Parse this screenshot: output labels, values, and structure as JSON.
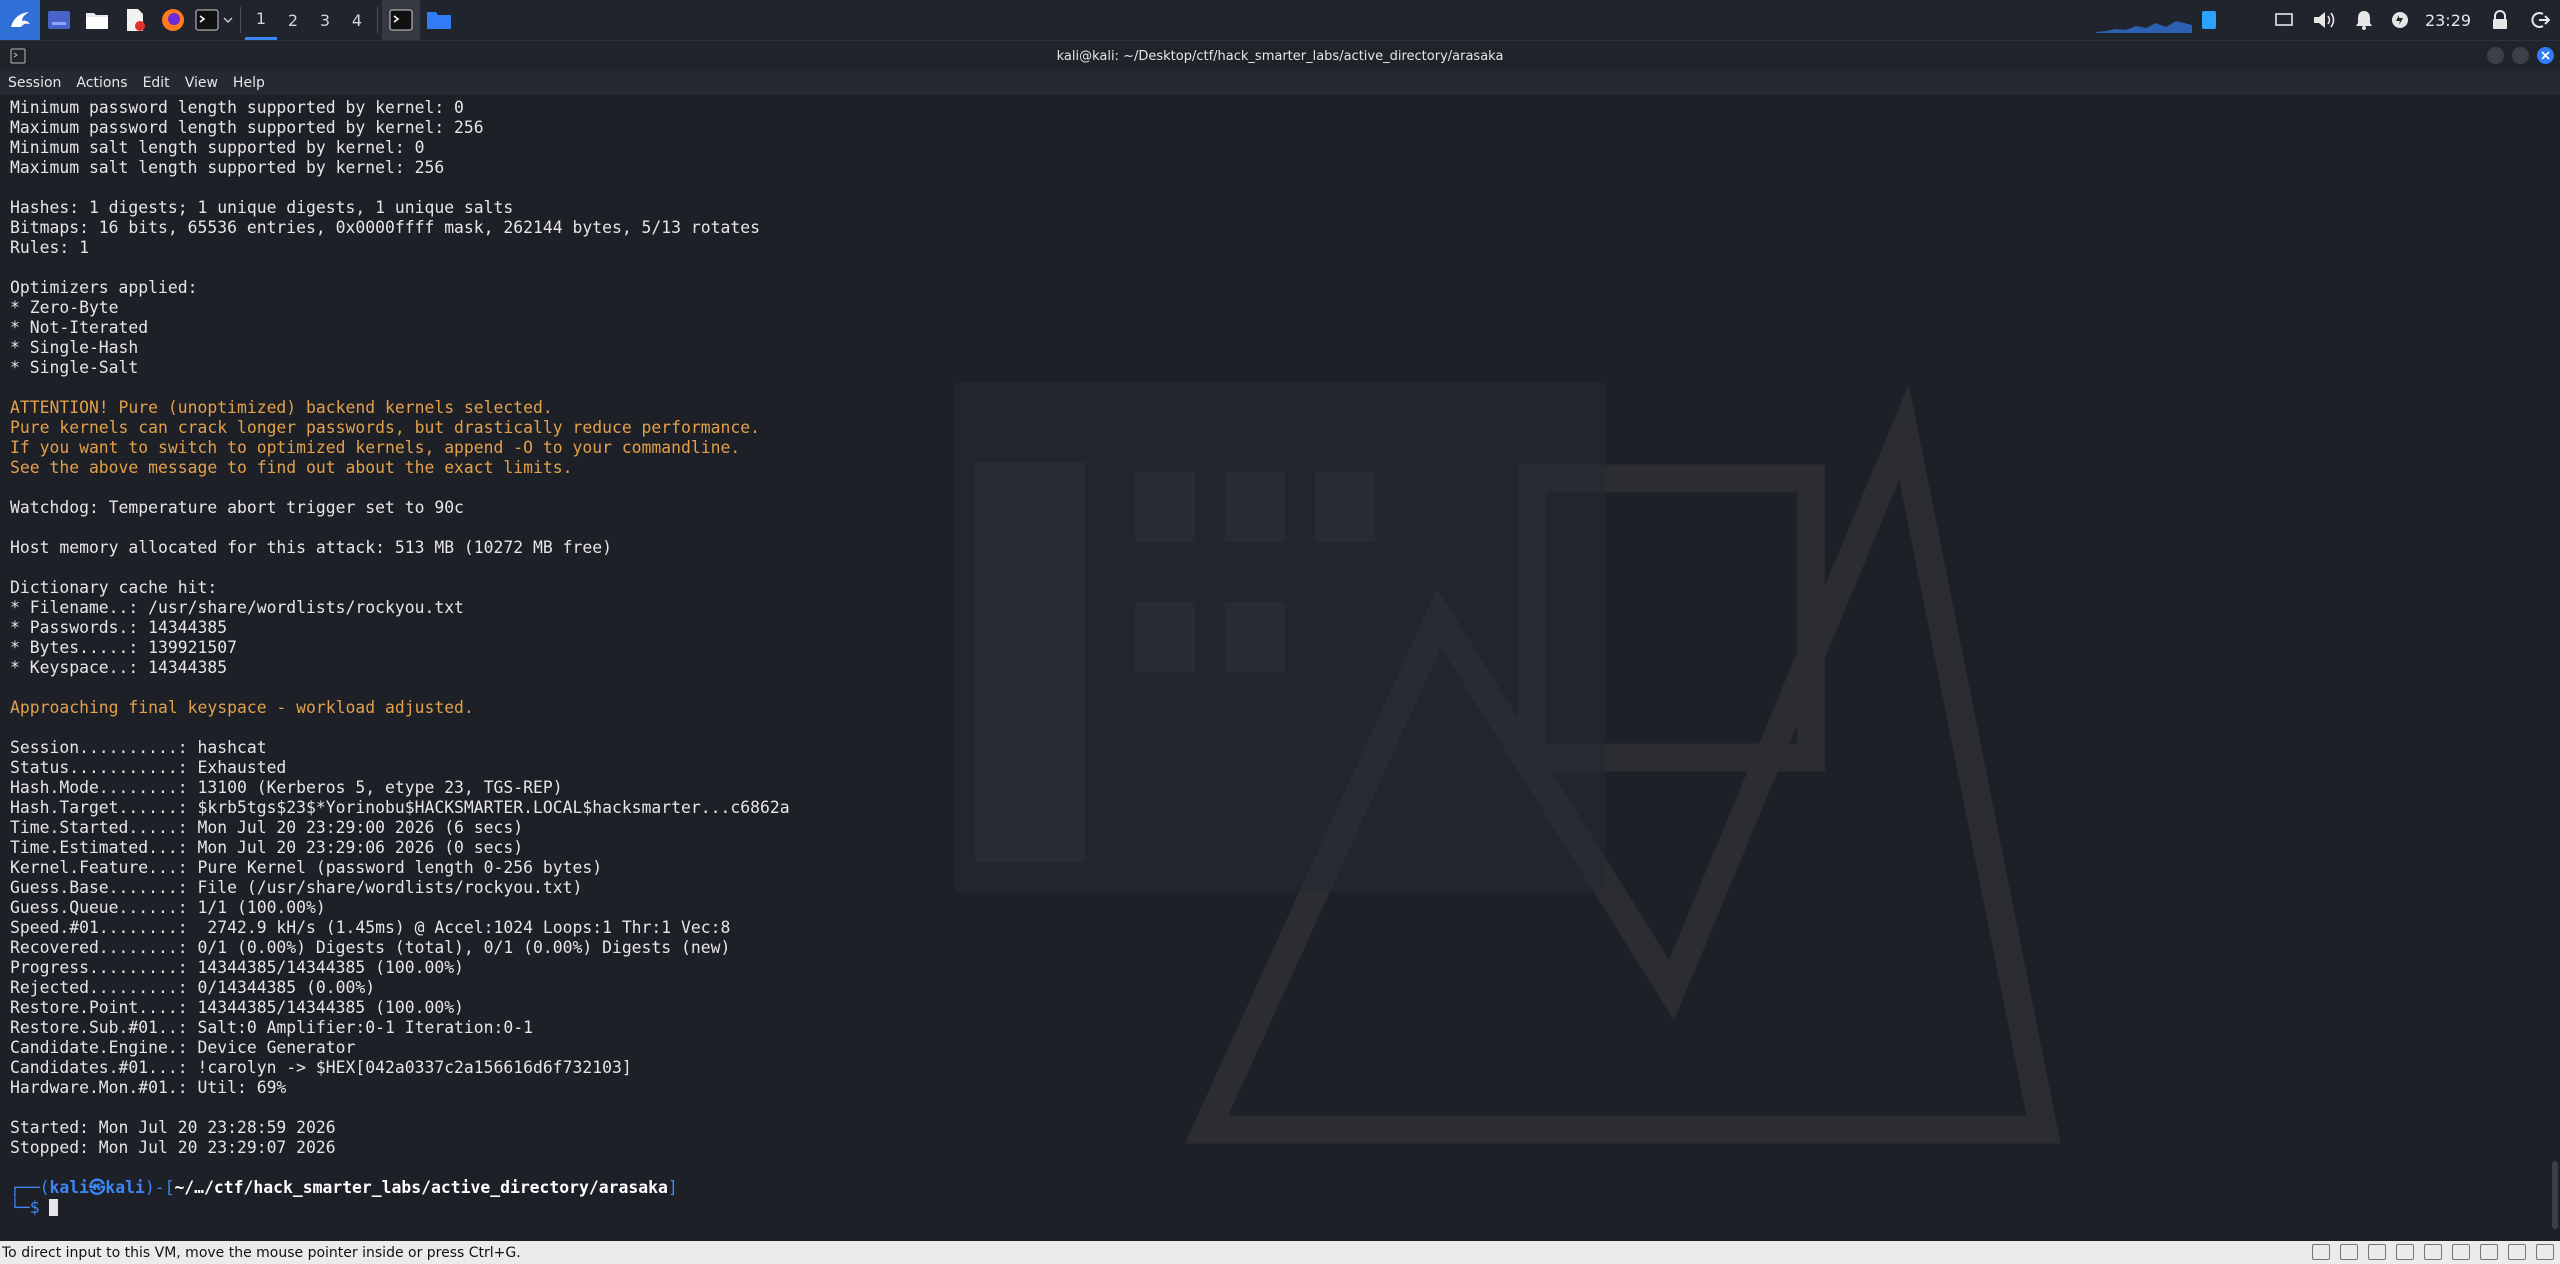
{
  "panel": {
    "workspaces": [
      "1",
      "2",
      "3",
      "4"
    ],
    "active_workspace": "1",
    "clock": "23:29",
    "accent_color": "#3d86f5"
  },
  "window": {
    "title": "kali@kali: ~/Desktop/ctf/hack_smarter_labs/active_directory/arasaka",
    "menu": [
      "Session",
      "Actions",
      "Edit",
      "View",
      "Help"
    ]
  },
  "terminal": {
    "lines": [
      {
        "text": "Minimum password length supported by kernel: 0",
        "style": "normal"
      },
      {
        "text": "Maximum password length supported by kernel: 256",
        "style": "normal"
      },
      {
        "text": "Minimum salt length supported by kernel: 0",
        "style": "normal"
      },
      {
        "text": "Maximum salt length supported by kernel: 256",
        "style": "normal"
      },
      {
        "text": "",
        "style": "normal"
      },
      {
        "text": "Hashes: 1 digests; 1 unique digests, 1 unique salts",
        "style": "normal"
      },
      {
        "text": "Bitmaps: 16 bits, 65536 entries, 0x0000ffff mask, 262144 bytes, 5/13 rotates",
        "style": "normal"
      },
      {
        "text": "Rules: 1",
        "style": "normal"
      },
      {
        "text": "",
        "style": "normal"
      },
      {
        "text": "Optimizers applied:",
        "style": "normal"
      },
      {
        "text": "* Zero-Byte",
        "style": "normal"
      },
      {
        "text": "* Not-Iterated",
        "style": "normal"
      },
      {
        "text": "* Single-Hash",
        "style": "normal"
      },
      {
        "text": "* Single-Salt",
        "style": "normal"
      },
      {
        "text": "",
        "style": "normal"
      },
      {
        "text": "ATTENTION! Pure (unoptimized) backend kernels selected.",
        "style": "warn"
      },
      {
        "text": "Pure kernels can crack longer passwords, but drastically reduce performance.",
        "style": "warn"
      },
      {
        "text": "If you want to switch to optimized kernels, append -O to your commandline.",
        "style": "warn"
      },
      {
        "text": "See the above message to find out about the exact limits.",
        "style": "warn"
      },
      {
        "text": "",
        "style": "normal"
      },
      {
        "text": "Watchdog: Temperature abort trigger set to 90c",
        "style": "normal"
      },
      {
        "text": "",
        "style": "normal"
      },
      {
        "text": "Host memory allocated for this attack: 513 MB (10272 MB free)",
        "style": "normal"
      },
      {
        "text": "",
        "style": "normal"
      },
      {
        "text": "Dictionary cache hit:",
        "style": "normal"
      },
      {
        "text": "* Filename..: /usr/share/wordlists/rockyou.txt",
        "style": "normal"
      },
      {
        "text": "* Passwords.: 14344385",
        "style": "normal"
      },
      {
        "text": "* Bytes.....: 139921507",
        "style": "normal"
      },
      {
        "text": "* Keyspace..: 14344385",
        "style": "normal"
      },
      {
        "text": "",
        "style": "normal"
      },
      {
        "text": "Approaching final keyspace - workload adjusted.",
        "style": "warn"
      },
      {
        "text": "",
        "style": "normal"
      },
      {
        "text": "Session..........: hashcat",
        "style": "normal"
      },
      {
        "text": "Status...........: Exhausted",
        "style": "normal"
      },
      {
        "text": "Hash.Mode........: 13100 (Kerberos 5, etype 23, TGS-REP)",
        "style": "normal"
      },
      {
        "text": "Hash.Target......: $krb5tgs$23$*Yorinobu$HACKSMARTER.LOCAL$hacksmarter...c6862a",
        "style": "normal"
      },
      {
        "text": "Time.Started.....: Mon Jul 20 23:29:00 2026 (6 secs)",
        "style": "normal"
      },
      {
        "text": "Time.Estimated...: Mon Jul 20 23:29:06 2026 (0 secs)",
        "style": "normal"
      },
      {
        "text": "Kernel.Feature...: Pure Kernel (password length 0-256 bytes)",
        "style": "normal"
      },
      {
        "text": "Guess.Base.......: File (/usr/share/wordlists/rockyou.txt)",
        "style": "normal"
      },
      {
        "text": "Guess.Queue......: 1/1 (100.00%)",
        "style": "normal"
      },
      {
        "text": "Speed.#01........:  2742.9 kH/s (1.45ms) @ Accel:1024 Loops:1 Thr:1 Vec:8",
        "style": "normal"
      },
      {
        "text": "Recovered........: 0/1 (0.00%) Digests (total), 0/1 (0.00%) Digests (new)",
        "style": "normal"
      },
      {
        "text": "Progress.........: 14344385/14344385 (100.00%)",
        "style": "normal"
      },
      {
        "text": "Rejected.........: 0/14344385 (0.00%)",
        "style": "normal"
      },
      {
        "text": "Restore.Point....: 14344385/14344385 (100.00%)",
        "style": "normal"
      },
      {
        "text": "Restore.Sub.#01..: Salt:0 Amplifier:0-1 Iteration:0-1",
        "style": "normal"
      },
      {
        "text": "Candidate.Engine.: Device Generator",
        "style": "normal"
      },
      {
        "text": "Candidates.#01...: !carolyn -> $HEX[042a0337c2a156616d6f732103]",
        "style": "normal"
      },
      {
        "text": "Hardware.Mon.#01.: Util: 69%",
        "style": "normal"
      },
      {
        "text": "",
        "style": "normal"
      },
      {
        "text": "Started: Mon Jul 20 23:28:59 2026",
        "style": "normal"
      },
      {
        "text": "Stopped: Mon Jul 20 23:29:07 2026",
        "style": "normal"
      },
      {
        "text": "",
        "style": "normal"
      }
    ],
    "prompt": {
      "open": "┌──(",
      "user": "kali㉿kali",
      "mid": ")-[",
      "path": "~/…/ctf/hack_smarter_labs/active_directory/arasaka",
      "close": "]",
      "second": "└─$ "
    }
  },
  "statusbar": {
    "message": "To direct input to this VM, move the mouse pointer inside or press Ctrl+G."
  }
}
